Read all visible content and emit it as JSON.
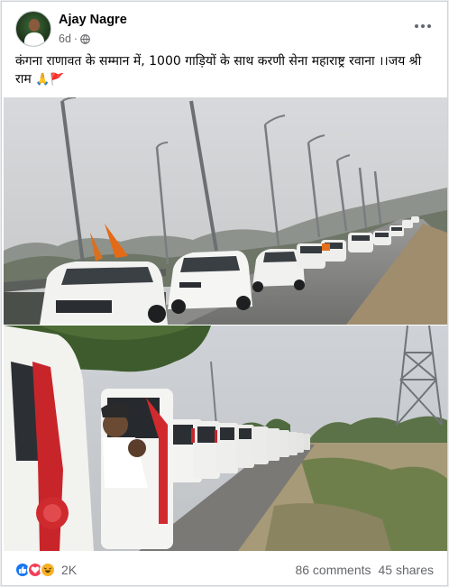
{
  "post": {
    "author": "Ajay Nagre",
    "time": "6d",
    "separator": "·",
    "text": "कंगना राणावत के सम्मान में, 1000 गाड़ियों के साथ करणी सेना महाराष्ट्र रवाना ।।जय श्री राम",
    "text_emojis": "🙏🚩",
    "privacy_icon": "globe-icon",
    "menu_icon": "more-horizontal-icon"
  },
  "footer": {
    "reaction_count": "2K",
    "comments": "86 comments",
    "shares": "45 shares",
    "reaction_icons": [
      "like-icon",
      "love-icon",
      "haha-icon"
    ]
  },
  "colors": {
    "like": "#1877f2",
    "love": "#f33e58",
    "haha": "#f7b125",
    "secondary_text": "#65676b"
  }
}
